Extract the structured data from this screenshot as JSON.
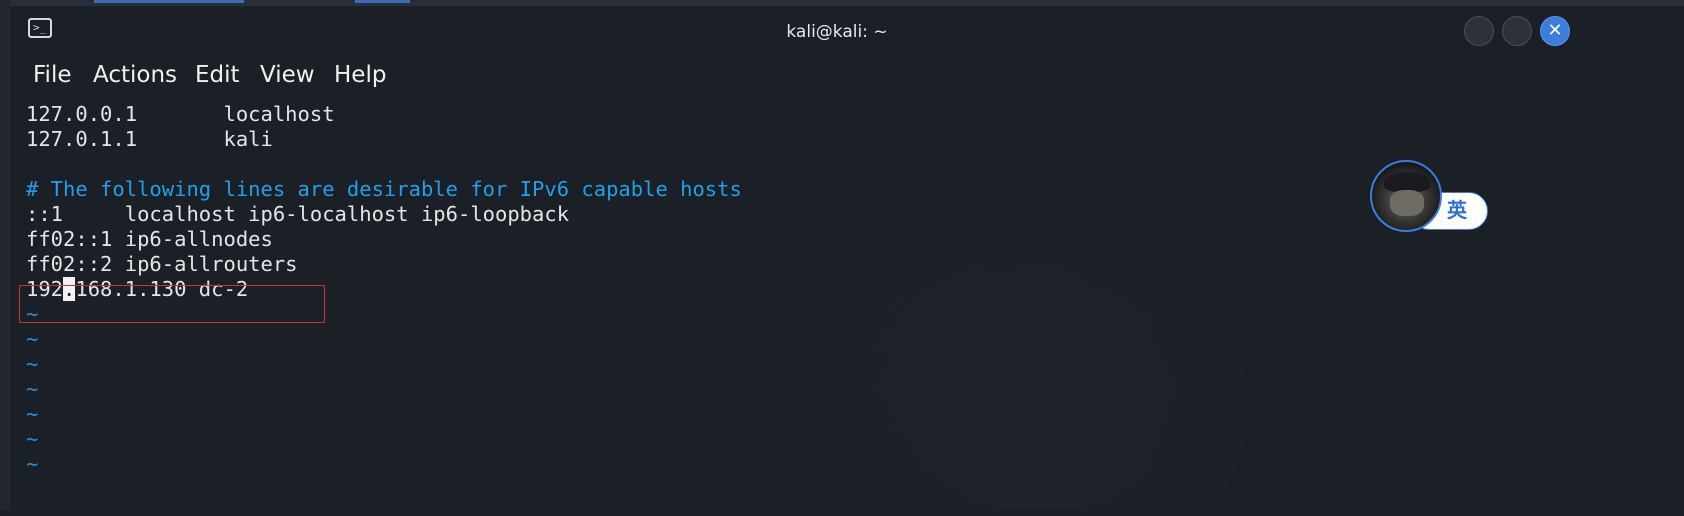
{
  "window": {
    "title": "kali@kali: ~",
    "close_glyph": "✕"
  },
  "menu": [
    {
      "label": "File"
    },
    {
      "label": "Actions"
    },
    {
      "label": "Edit"
    },
    {
      "label": "View"
    },
    {
      "label": "Help"
    }
  ],
  "editor": {
    "lines": [
      {
        "text": "127.0.0.1       localhost",
        "kind": "normal"
      },
      {
        "text": "127.0.1.1       kali",
        "kind": "normal"
      },
      {
        "text": "",
        "kind": "normal"
      },
      {
        "text": "# The following lines are desirable for IPv6 capable hosts",
        "kind": "comment"
      },
      {
        "text": "::1     localhost ip6-localhost ip6-loopback",
        "kind": "normal"
      },
      {
        "text": "ff02::1 ip6-allnodes",
        "kind": "normal"
      },
      {
        "text": "ff02::2 ip6-allrouters",
        "kind": "normal"
      }
    ],
    "edited_line": {
      "before_cursor": "192",
      "cursor_char": ".",
      "after_cursor": "168.1.130 dc-2"
    },
    "tilde_lines": [
      "~",
      "~",
      "~",
      "~",
      "~",
      "~",
      "~"
    ]
  },
  "ime": {
    "label": "英"
  },
  "colors": {
    "comment": "#1fa0e8",
    "highlight_border": "#c4363a",
    "accent": "#3b7ddd"
  }
}
